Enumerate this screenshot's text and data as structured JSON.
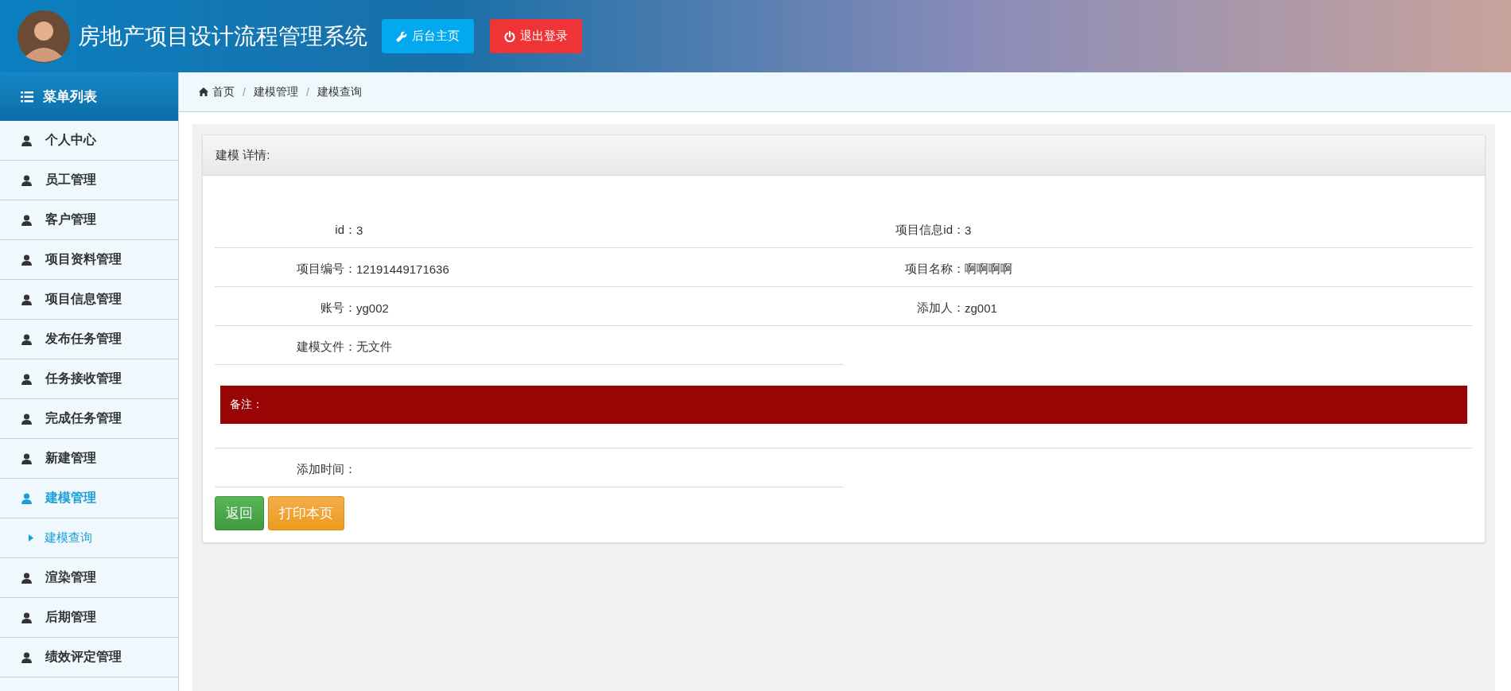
{
  "header": {
    "title": "房地产项目设计流程管理系统",
    "buttons": [
      {
        "label": "后台主页",
        "kind": "home"
      },
      {
        "label": "退出登录",
        "kind": "logout"
      }
    ]
  },
  "sidebar": {
    "title": "菜单列表",
    "items": [
      {
        "label": "个人中心",
        "selected": false
      },
      {
        "label": "员工管理",
        "selected": false
      },
      {
        "label": "客户管理",
        "selected": false
      },
      {
        "label": "项目资料管理",
        "selected": false
      },
      {
        "label": "项目信息管理",
        "selected": false
      },
      {
        "label": "发布任务管理",
        "selected": false
      },
      {
        "label": "任务接收管理",
        "selected": false
      },
      {
        "label": "完成任务管理",
        "selected": false
      },
      {
        "label": "新建管理",
        "selected": false
      },
      {
        "label": "建模管理",
        "selected": true,
        "children": [
          {
            "label": "建模查询",
            "selected": true
          }
        ]
      },
      {
        "label": "渲染管理",
        "selected": false
      },
      {
        "label": "后期管理",
        "selected": false
      },
      {
        "label": "绩效评定管理",
        "selected": false
      }
    ]
  },
  "breadcrumb": {
    "separator": "/",
    "items": [
      {
        "label": "首页",
        "kind": "home"
      },
      {
        "label": "建模管理"
      },
      {
        "label": "建模查询"
      }
    ]
  },
  "detail": {
    "title": "建模 详情:",
    "fields": [
      {
        "label": "id：",
        "value": "3"
      },
      {
        "label": "项目信息id：",
        "value": "3"
      },
      {
        "label": "项目编号：",
        "value": "12191449171636"
      },
      {
        "label": "项目名称：",
        "value": "啊啊啊啊"
      },
      {
        "label": "账号：",
        "value": "yg002"
      },
      {
        "label": "添加人：",
        "value": "zg001"
      },
      {
        "label": "建模文件：",
        "value": "无文件"
      }
    ],
    "remark": {
      "label": "备注："
    },
    "footer_fields": [
      {
        "label": "添加时间："
      }
    ],
    "buttons": [
      {
        "label": "返回",
        "kind": "success"
      },
      {
        "label": "打印本页",
        "kind": "warning"
      }
    ]
  }
}
